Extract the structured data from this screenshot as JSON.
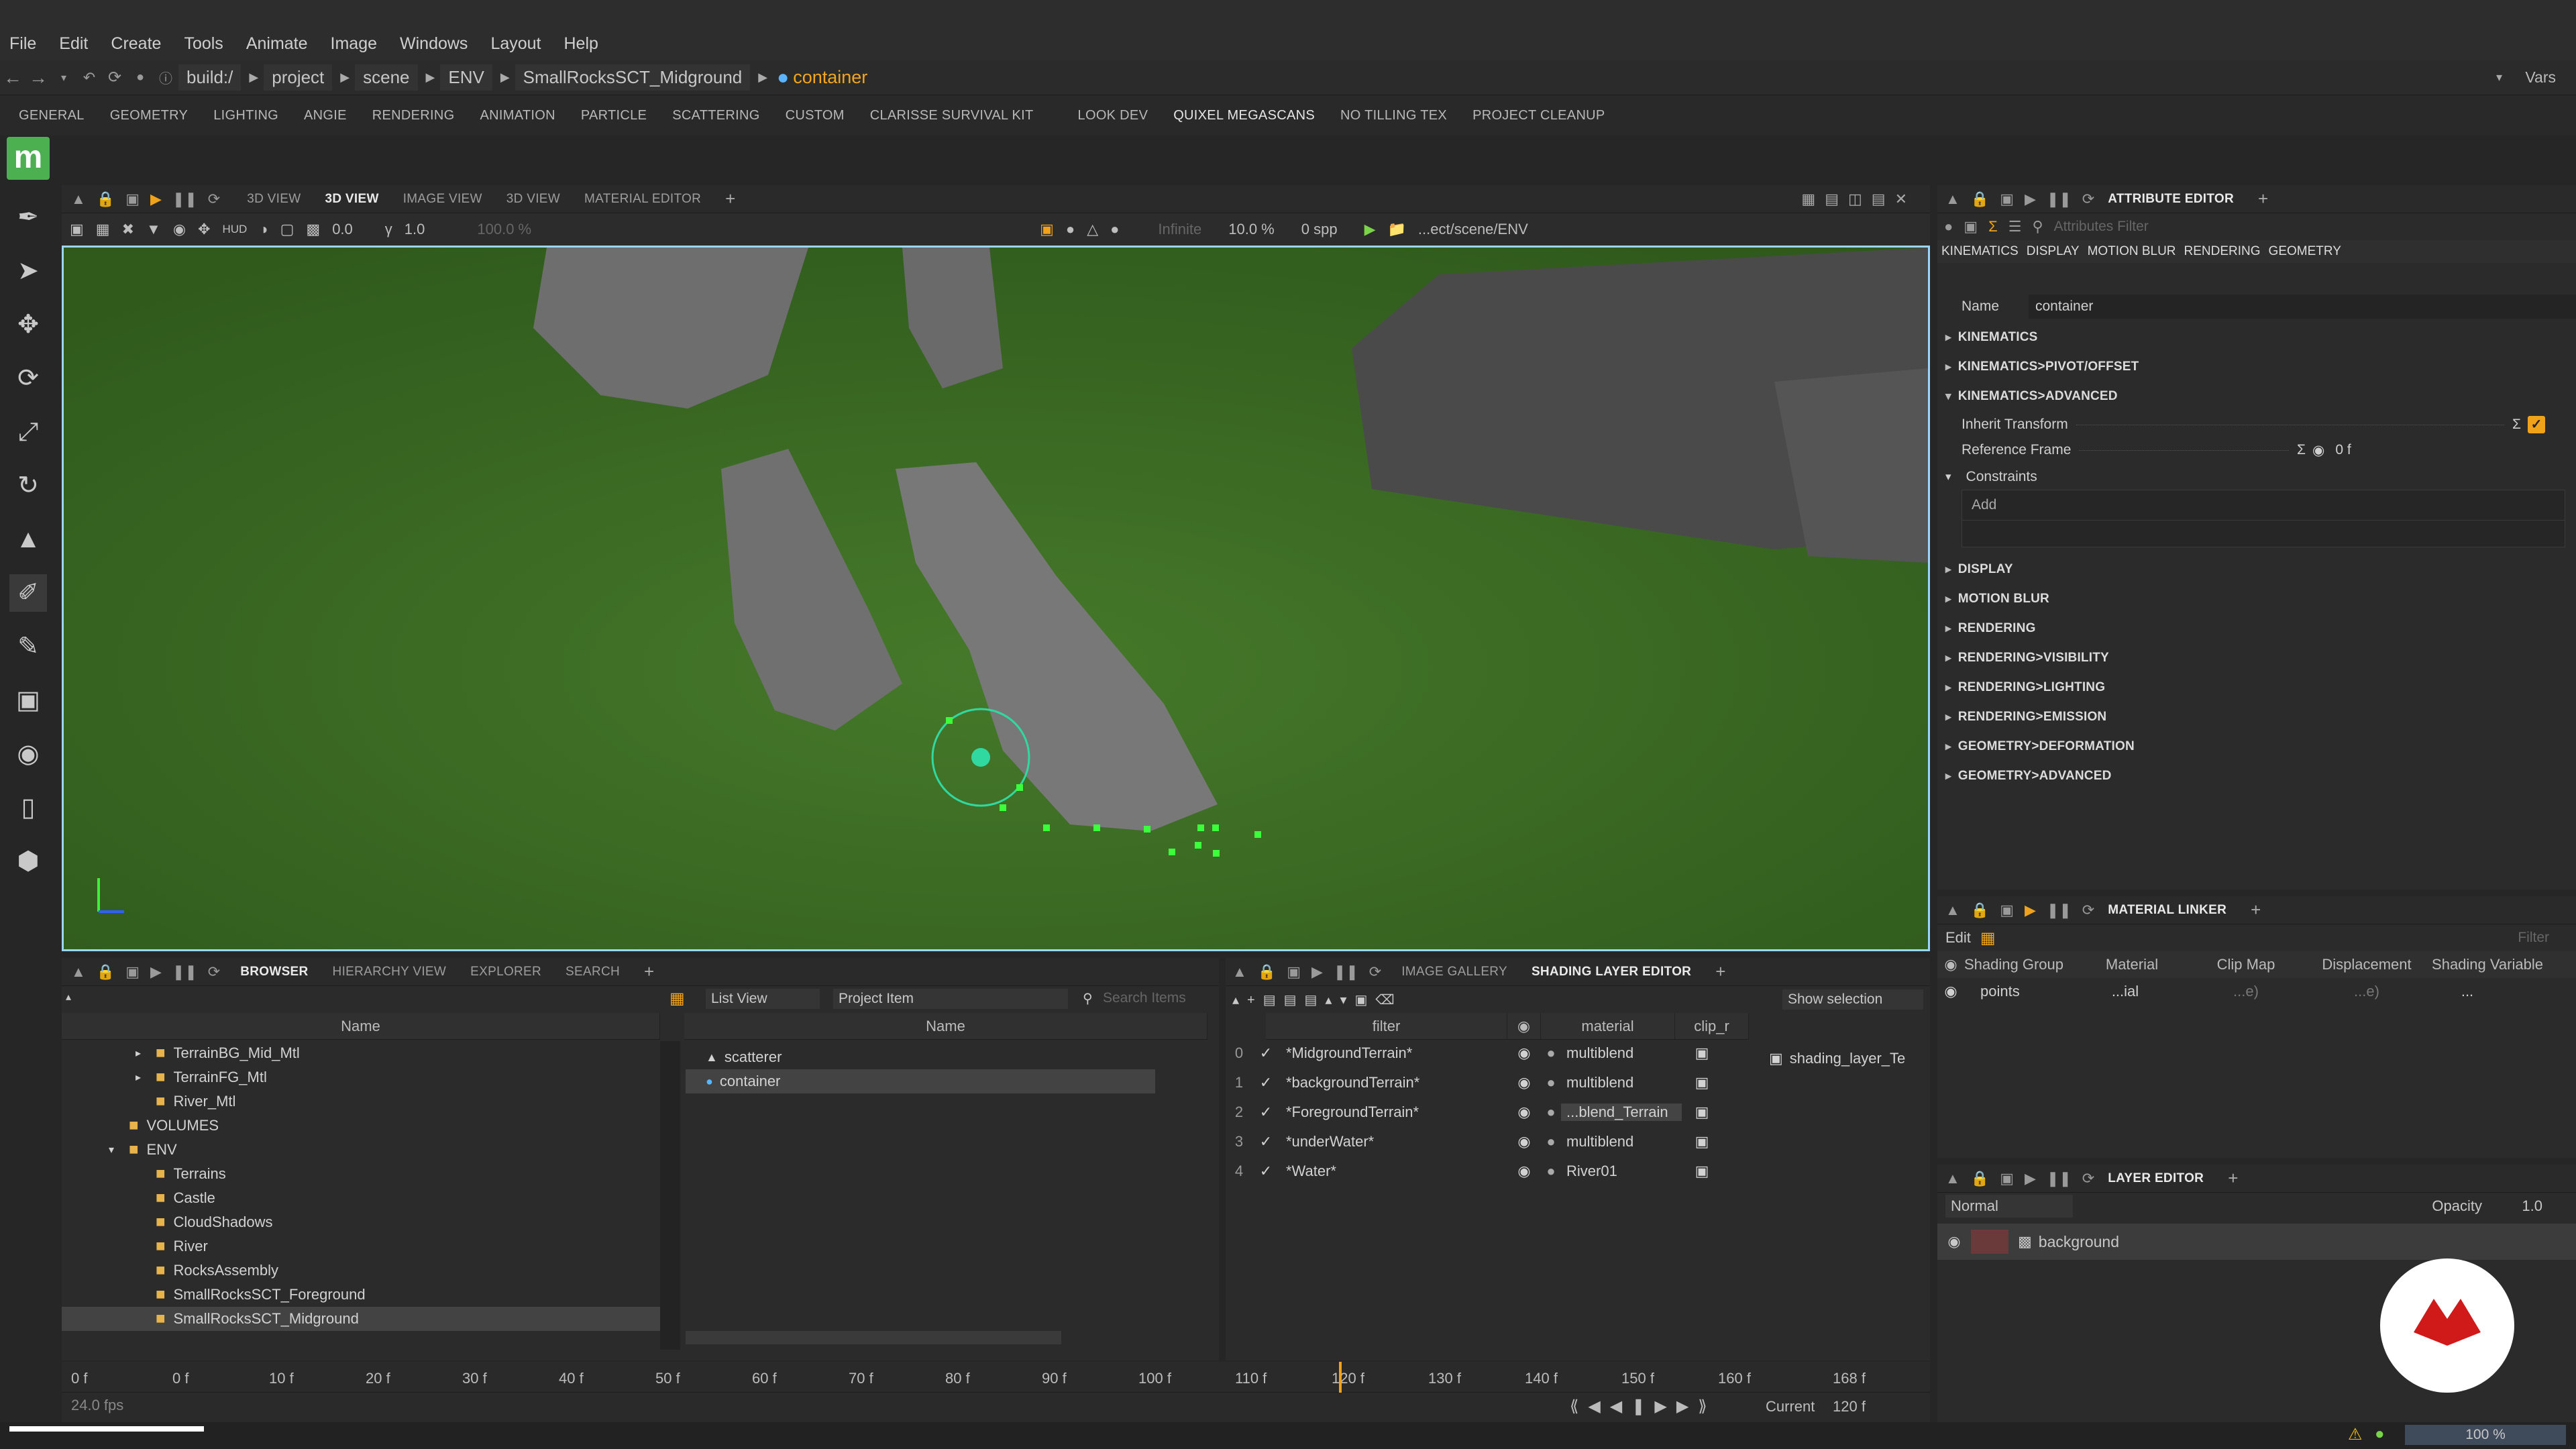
{
  "menu": [
    "File",
    "Edit",
    "Create",
    "Tools",
    "Animate",
    "Image",
    "Windows",
    "Layout",
    "Help"
  ],
  "address": {
    "crumbs": [
      "build:/",
      "project",
      "scene",
      "ENV",
      "SmallRocksSCT_Midground"
    ],
    "current": "container",
    "vars": "Vars"
  },
  "shelf": {
    "tabs": [
      "GENERAL",
      "GEOMETRY",
      "LIGHTING",
      "ANGIE",
      "RENDERING",
      "ANIMATION",
      "PARTICLE",
      "SCATTERING",
      "CUSTOM",
      "CLARISSE SURVIVAL KIT",
      "LOOK DEV",
      "QUIXEL MEGASCANS",
      "NO TILLING TEX",
      "PROJECT CLEANUP"
    ],
    "active": "QUIXEL MEGASCANS"
  },
  "logo": "m",
  "viewport": {
    "tabs": [
      "3D VIEW",
      "3D VIEW",
      "IMAGE VIEW",
      "3D VIEW",
      "MATERIAL EDITOR"
    ],
    "active_tab": "3D VIEW",
    "toolbar": {
      "hud": "HUD",
      "val1": "0.0",
      "val2": "1.0",
      "val3": "100.0 %",
      "infinite": "Infinite",
      "percent": "10.0 %",
      "spp": "0 spp",
      "path": "...ect/scene/ENV"
    }
  },
  "attribute_editor": {
    "title": "ATTRIBUTE EDITOR",
    "filter_placeholder": "Attributes Filter",
    "tabs": [
      "KINEMATICS",
      "DISPLAY",
      "MOTION BLUR",
      "RENDERING",
      "GEOMETRY"
    ],
    "name_label": "Name",
    "name_value": "container",
    "sections": [
      "KINEMATICS",
      "KINEMATICS>PIVOT/OFFSET",
      "KINEMATICS>ADVANCED"
    ],
    "inherit_label": "Inherit Transform",
    "ref_label": "Reference Frame",
    "ref_value": "0 f",
    "constraints_label": "Constraints",
    "add_label": "Add",
    "more_sections": [
      "DISPLAY",
      "MOTION BLUR",
      "RENDERING",
      "RENDERING>VISIBILITY",
      "RENDERING>LIGHTING",
      "RENDERING>EMISSION",
      "GEOMETRY>DEFORMATION",
      "GEOMETRY>ADVANCED"
    ]
  },
  "material_linker": {
    "title": "MATERIAL LINKER",
    "edit": "Edit",
    "filter_placeholder": "Filter",
    "columns": [
      "Shading Group",
      "Material",
      "Clip Map",
      "Displacement",
      "Shading Variable"
    ],
    "row": {
      "group": "points",
      "material": "...ial",
      "clip": "...e)",
      "disp": "...e)",
      "var": "..."
    }
  },
  "layer_editor": {
    "title": "LAYER EDITOR",
    "mode": "Normal",
    "opacity_label": "Opacity",
    "opacity": "1.0",
    "layer": "background"
  },
  "browser": {
    "tabs": [
      "BROWSER",
      "HIERARCHY VIEW",
      "EXPLORER",
      "SEARCH"
    ],
    "list_view": "List View",
    "project_item": "Project Item",
    "search_placeholder": "Search Items",
    "tree_header": "Name",
    "list_header": "Name",
    "tree": [
      {
        "label": "TerrainBG_Mid_Mtl",
        "depth": 2,
        "arrow": true
      },
      {
        "label": "TerrainFG_Mtl",
        "depth": 2,
        "arrow": true
      },
      {
        "label": "River_Mtl",
        "depth": 2,
        "arrow": false
      },
      {
        "label": "VOLUMES",
        "depth": 1,
        "arrow": false
      },
      {
        "label": "ENV",
        "depth": 1,
        "arrow": true
      },
      {
        "label": "Terrains",
        "depth": 2,
        "arrow": false
      },
      {
        "label": "Castle",
        "depth": 2,
        "arrow": false
      },
      {
        "label": "CloudShadows",
        "depth": 2,
        "arrow": false
      },
      {
        "label": "River",
        "depth": 2,
        "arrow": false
      },
      {
        "label": "RocksAssembly",
        "depth": 2,
        "arrow": false
      },
      {
        "label": "SmallRocksSCT_Foreground",
        "depth": 2,
        "arrow": false
      },
      {
        "label": "SmallRocksSCT_Midground",
        "depth": 2,
        "arrow": false
      }
    ],
    "items": [
      "scatterer",
      "container"
    ]
  },
  "shading": {
    "tabs": [
      "IMAGE GALLERY",
      "SHADING LAYER EDITOR"
    ],
    "show_selection": "Show selection",
    "columns": [
      "filter",
      "material",
      "clip_r"
    ],
    "rows": [
      {
        "idx": "0",
        "filter": "*MidgroundTerrain*",
        "material": "multiblend"
      },
      {
        "idx": "1",
        "filter": "*backgroundTerrain*",
        "material": "multiblend"
      },
      {
        "idx": "2",
        "filter": "*ForegroundTerrain*",
        "material": "...blend_Terrain"
      },
      {
        "idx": "3",
        "filter": "*underWater*",
        "material": "multiblend"
      },
      {
        "idx": "4",
        "filter": "*Water*",
        "material": "River01"
      }
    ],
    "side_item": "shading_layer_Te"
  },
  "timeline": {
    "start": "0 f",
    "ticks": [
      "0 f",
      "10 f",
      "20 f",
      "30 f",
      "40 f",
      "50 f",
      "60 f",
      "70 f",
      "80 f",
      "90 f",
      "100 f",
      "110 f",
      "120 f",
      "130 f",
      "140 f",
      "150 f",
      "160 f"
    ],
    "end": "168 f",
    "fps": "24.0 fps",
    "current_label": "Current",
    "current": "120 f"
  },
  "status": {
    "zoom": "100 %"
  }
}
